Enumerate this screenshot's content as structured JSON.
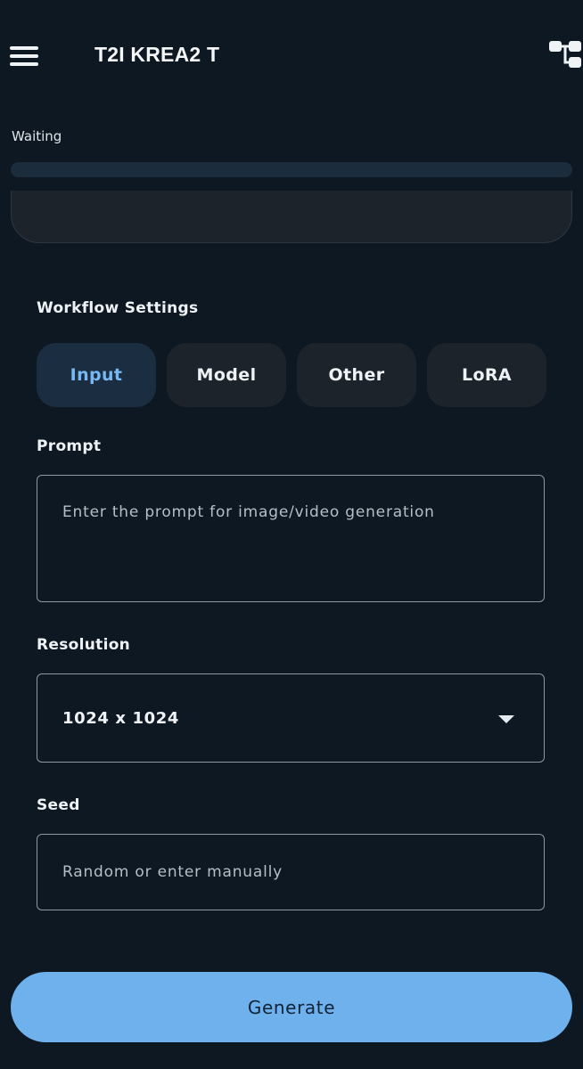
{
  "header": {
    "title": "T2I KREA2 T",
    "menu_icon": "hamburger-menu-icon",
    "workflow_icon": "workflow-tree-icon"
  },
  "status": {
    "label": "Waiting",
    "progress": 0
  },
  "workflow_settings": {
    "title": "Workflow Settings",
    "tabs": [
      {
        "label": "Input",
        "active": true
      },
      {
        "label": "Model",
        "active": false
      },
      {
        "label": "Other",
        "active": false
      },
      {
        "label": "LoRA",
        "active": false
      }
    ]
  },
  "prompt": {
    "label": "Prompt",
    "placeholder": "Enter the prompt for image/video generation",
    "value": ""
  },
  "resolution": {
    "label": "Resolution",
    "value": "1024 x 1024"
  },
  "seed": {
    "label": "Seed",
    "placeholder": "Random or enter manually",
    "value": ""
  },
  "actions": {
    "generate_label": "Generate"
  },
  "colors": {
    "background": "#0e1822",
    "accent": "#6eb1ec",
    "active_tab_text": "#78b8f2",
    "tab_background": "#1c232b"
  }
}
